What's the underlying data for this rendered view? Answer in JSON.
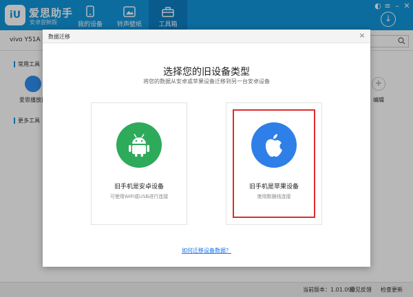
{
  "app": {
    "logo_text": "iU",
    "name": "爱思助手",
    "subtitle": "安卓尝鲜版"
  },
  "nav": {
    "tabs": [
      {
        "label": "我的设备",
        "icon": "phone-icon"
      },
      {
        "label": "铃声壁纸",
        "icon": "wallpaper-icon"
      },
      {
        "label": "工具箱",
        "icon": "toolbox-icon",
        "active": true
      }
    ]
  },
  "window": {
    "download_icon": "download-icon"
  },
  "device": {
    "name": "vivo Y51A"
  },
  "tools": {
    "common_label": "常用工具",
    "more_label": "更多工具",
    "tool_label": "爱思播放器",
    "edit_label": "编辑"
  },
  "statusbar": {
    "version": "当前版本：1.01.090",
    "feedback": "意见反馈",
    "check_update": "检查更新"
  },
  "dialog": {
    "title": "数据迁移",
    "heading": "选择您的旧设备类型",
    "subheading": "将您的数据从安卓或苹果设备迁移到另一台安卓设备",
    "cards": [
      {
        "title": "旧手机是安卓设备",
        "desc": "可使用WiFi或USB进行连接",
        "icon": "android-icon",
        "color": "#2eaa5b"
      },
      {
        "title": "旧手机是苹果设备",
        "desc": "使用数据线连接",
        "icon": "apple-icon",
        "color": "#2f7fe8",
        "selected": true
      }
    ],
    "help_link": "如何迁移设备数据？"
  },
  "colors": {
    "brand": "#1296db",
    "highlight": "#e02b2b",
    "link": "#1a73e8"
  }
}
